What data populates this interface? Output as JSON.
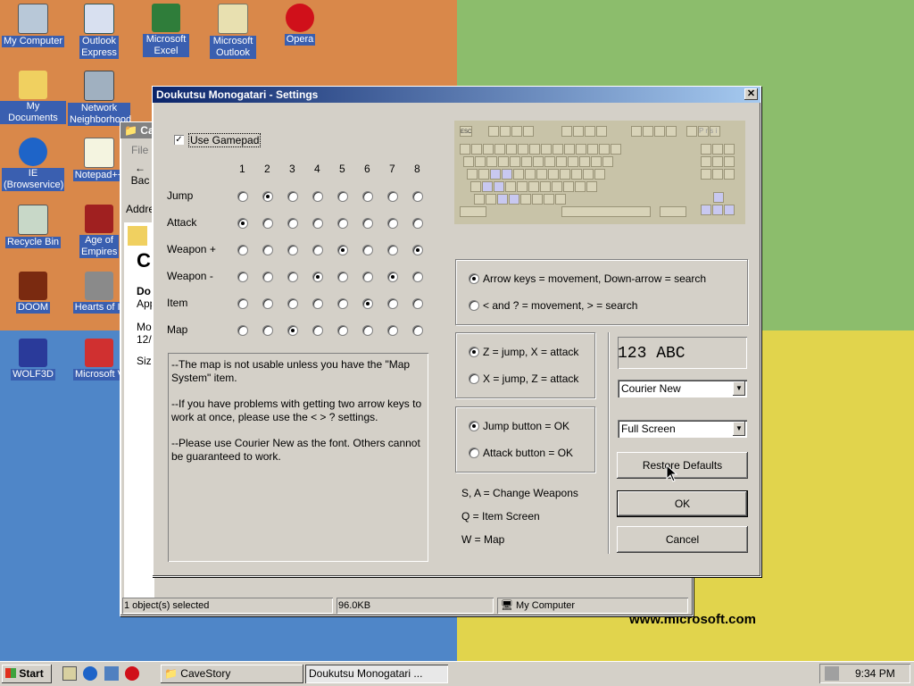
{
  "desktop": {
    "icons": [
      {
        "label": "My Computer"
      },
      {
        "label": "Outlook Express"
      },
      {
        "label": "Microsoft Excel"
      },
      {
        "label": "Microsoft Outlook"
      },
      {
        "label": "Opera"
      },
      {
        "label": "My Documents"
      },
      {
        "label": "Network Neighborhood"
      },
      {
        "label": "IE (Browservice)"
      },
      {
        "label": "Notepad++"
      },
      {
        "label": "Recycle Bin"
      },
      {
        "label": "Age of Empires"
      },
      {
        "label": "DOOM"
      },
      {
        "label": "Hearts of Ir"
      },
      {
        "label": "WOLF3D"
      },
      {
        "label": "Microsoft Visual Inte"
      }
    ],
    "watermark": "www.microsoft.com"
  },
  "explorer": {
    "title": "Ca",
    "menu_file": "File",
    "back_label": "Bac",
    "address_label": "Addre",
    "big_title": "C",
    "detail_lines": [
      "Do",
      "App",
      "Mo",
      "12/",
      "Siz"
    ],
    "status": {
      "selected": "1 object(s) selected",
      "size": "96.0KB",
      "location": "My Computer"
    }
  },
  "dialog": {
    "title": "Doukutsu Monogatari - Settings",
    "use_gamepad": {
      "label": "Use Gamepad",
      "checked": true
    },
    "gamepad_columns": [
      "1",
      "2",
      "3",
      "4",
      "5",
      "6",
      "7",
      "8"
    ],
    "gamepad_rows": [
      {
        "label": "Jump",
        "selected": 2
      },
      {
        "label": "Attack",
        "selected": 1
      },
      {
        "label": "Weapon +",
        "selected": [
          5,
          8
        ]
      },
      {
        "label": "Weapon -",
        "selected": [
          4,
          7
        ]
      },
      {
        "label": "Item",
        "selected": 6
      },
      {
        "label": "Map",
        "selected": 3
      }
    ],
    "notes": [
      "--The map is not usable unless you have the \"Map System\" item.",
      "--If you have problems with getting two arrow keys to work at once, please use the < > ? settings.",
      "--Please use Courier New as the font. Others cannot be guaranteed to work."
    ],
    "keyboard": {
      "esc_label": "ESC",
      "print_label": "P r s i"
    },
    "movement_options": [
      {
        "label": "Arrow keys = movement, Down-arrow = search",
        "checked": true
      },
      {
        "label": "< and ? = movement, > = search",
        "checked": false
      }
    ],
    "jump_options": [
      {
        "label": "Z = jump, X = attack",
        "checked": true
      },
      {
        "label": "X = jump, Z = attack",
        "checked": false
      }
    ],
    "ok_options": [
      {
        "label": "Jump button = OK",
        "checked": true
      },
      {
        "label": "Attack button = OK",
        "checked": false
      }
    ],
    "shortcuts": [
      "S, A = Change Weapons",
      "Q = Item Screen",
      "W = Map"
    ],
    "font_preview": "123 ABC",
    "font_select": "Courier New",
    "display_select": "Full Screen",
    "restore_label": "Restore Defaults",
    "ok_label": "OK",
    "cancel_label": "Cancel"
  },
  "taskbar": {
    "start_label": "Start",
    "tasks": [
      {
        "label": "CaveStory",
        "active": false
      },
      {
        "label": "Doukutsu Monogatari ...",
        "active": true
      }
    ],
    "clock": "9:34 PM"
  },
  "colors": {
    "title_active": "#0a246a",
    "title_gradient_end": "#a6caf0",
    "face": "#d4d0c8",
    "desktop_orange": "#d98a4a",
    "desktop_green": "#8db86a",
    "desktop_blue": "#4f86c8",
    "desktop_yellow": "#e2d84a"
  }
}
